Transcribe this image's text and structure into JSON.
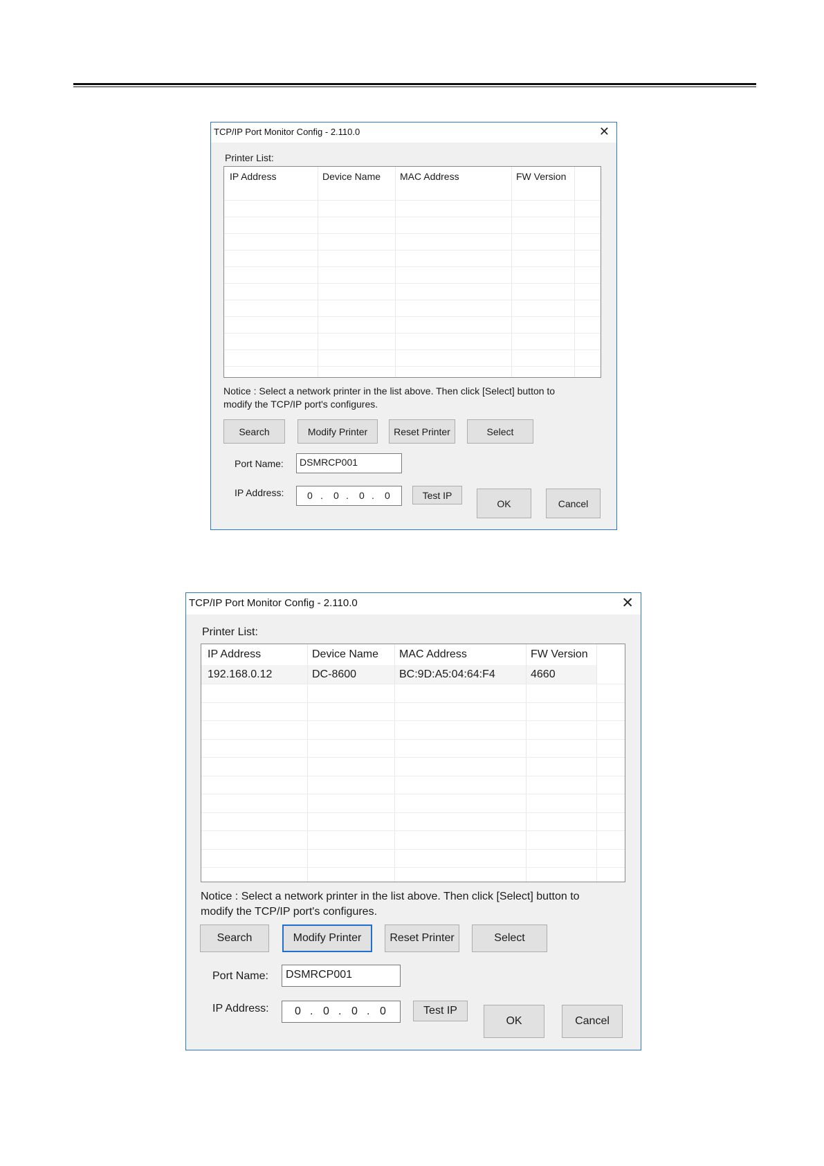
{
  "dialogs": [
    {
      "title": "TCP/IP Port Monitor Config - 2.110.0",
      "close_icon": "close-icon",
      "printer_list_label": "Printer List:",
      "columns": [
        "IP Address",
        "Device Name",
        "MAC Address",
        "FW Version"
      ],
      "rows": [],
      "notice_line1": "Notice : Select a network printer in the list above. Then click [Select] button to",
      "notice_line2": "modify the TCP/IP port's configures.",
      "buttons": {
        "search": "Search",
        "modify": "Modify Printer",
        "reset": "Reset Printer",
        "select": "Select",
        "test_ip": "Test IP",
        "ok": "OK",
        "cancel": "Cancel"
      },
      "port_name_label": "Port Name:",
      "port_name_value": "DSMRCP001",
      "ip_address_label": "IP Address:",
      "ip_octets": [
        "0",
        "0",
        "0",
        "0"
      ]
    },
    {
      "title": "TCP/IP Port Monitor Config - 2.110.0",
      "close_icon": "close-icon",
      "printer_list_label": "Printer List:",
      "columns": [
        "IP Address",
        "Device Name",
        "MAC Address",
        "FW Version"
      ],
      "rows": [
        {
          "ip": "192.168.0.12",
          "device": "DC-8600",
          "mac": "BC:9D:A5:04:64:F4",
          "fw": "4660"
        }
      ],
      "notice_line1": "Notice : Select a network printer in the list above. Then click [Select] button to",
      "notice_line2": "modify the TCP/IP port's configures.",
      "buttons": {
        "search": "Search",
        "modify": "Modify Printer",
        "reset": "Reset Printer",
        "select": "Select",
        "test_ip": "Test IP",
        "ok": "OK",
        "cancel": "Cancel"
      },
      "port_name_label": "Port Name:",
      "port_name_value": "DSMRCP001",
      "ip_address_label": "IP Address:",
      "ip_octets": [
        "0",
        "0",
        "0",
        "0"
      ]
    }
  ]
}
